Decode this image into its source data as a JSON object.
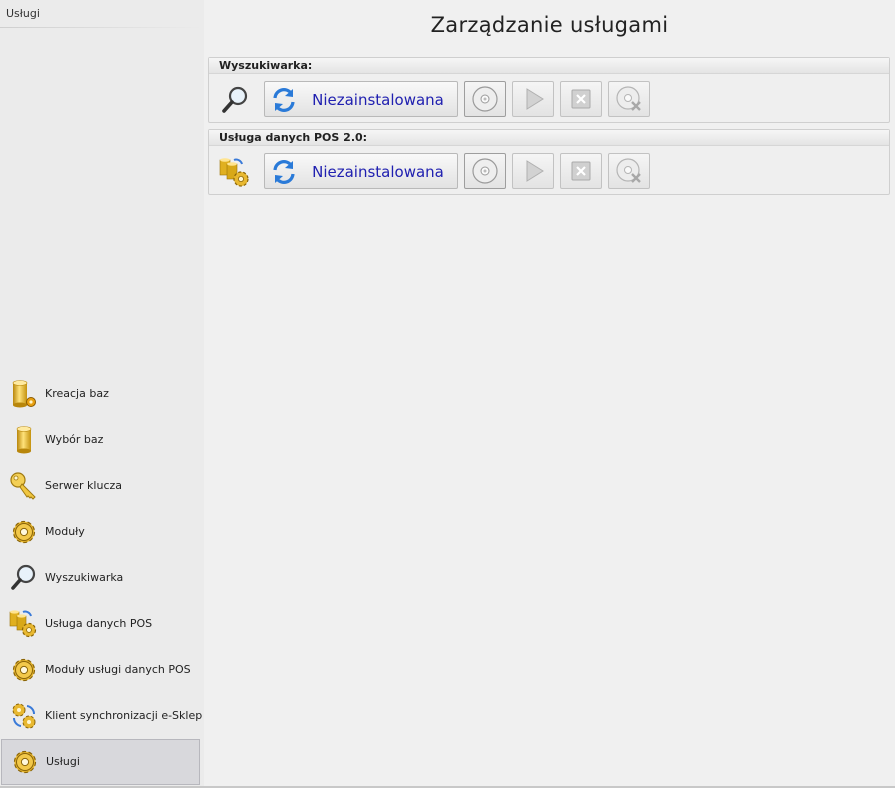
{
  "sidebar": {
    "title": "Usługi",
    "items": [
      {
        "label": "Kreacja baz",
        "icon": "database-gear-icon"
      },
      {
        "label": "Wybór baz",
        "icon": "database-icon"
      },
      {
        "label": "Serwer klucza",
        "icon": "key-icon"
      },
      {
        "label": "Moduły",
        "icon": "gear-icon"
      },
      {
        "label": "Wyszukiwarka",
        "icon": "magnifier-icon"
      },
      {
        "label": "Usługa danych POS",
        "icon": "database-service-icon"
      },
      {
        "label": "Moduły usługi danych POS",
        "icon": "gear-icon"
      },
      {
        "label": "Klient synchronizacji e-Sklep/ws:",
        "icon": "sync-gear-icon"
      },
      {
        "label": "Usługi",
        "icon": "gear-icon",
        "active": true
      }
    ]
  },
  "main": {
    "title": "Zarządzanie usługami",
    "services": [
      {
        "header": "Wyszukiwarka:",
        "icon": "magnifier-icon",
        "status": "Niezainstalowana"
      },
      {
        "header": "Usługa danych POS 2.0:",
        "icon": "database-service-icon",
        "status": "Niezainstalowana"
      }
    ]
  },
  "colors": {
    "status_text": "#2020b0",
    "active_item_bg": "#d8d8dc",
    "gear": "#e8b830",
    "database": "#e0b020"
  }
}
